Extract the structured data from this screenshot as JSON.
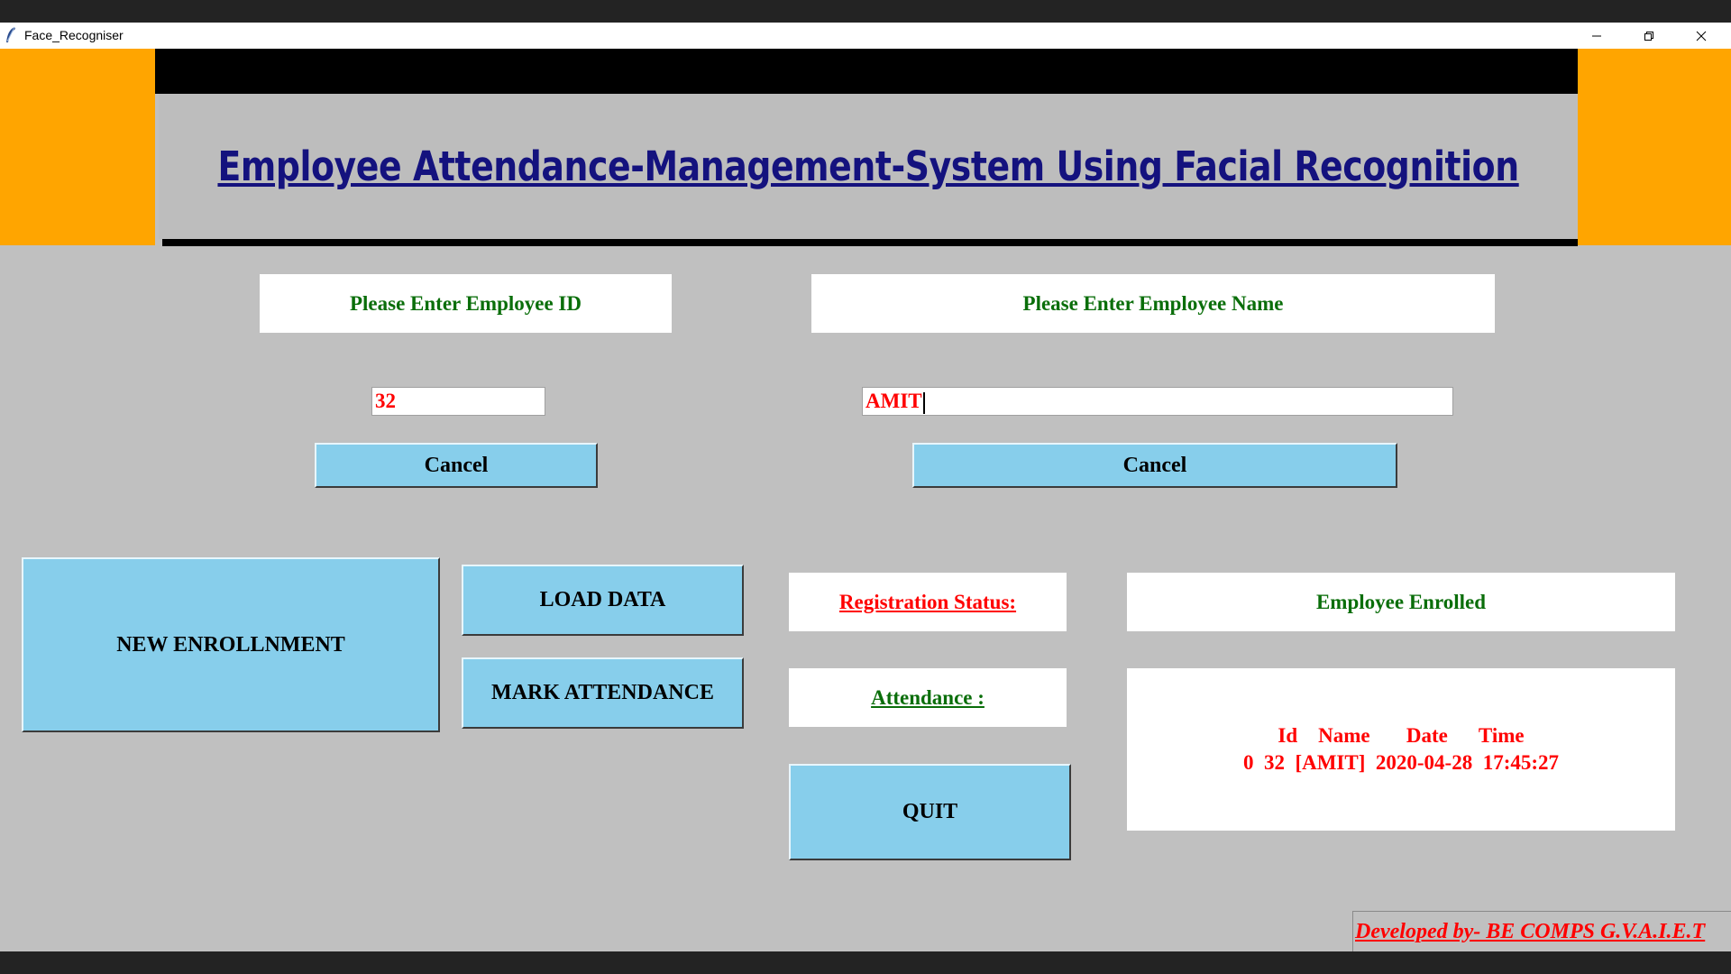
{
  "window": {
    "title": "Face_Recogniser",
    "controls": [
      "minimize-icon",
      "restore-icon",
      "close-icon"
    ]
  },
  "header": {
    "title": "Employee Attendance-Management-System Using Facial Recognition"
  },
  "form": {
    "id_label": "Please Enter Employee ID",
    "name_label": "Please Enter Employee Name",
    "id_value": "32",
    "name_value": "AMIT",
    "cancel_id_label": "Cancel",
    "cancel_name_label": "Cancel"
  },
  "actions": {
    "new_enrollment": "NEW ENROLLNMENT",
    "load_data": "LOAD DATA",
    "mark_attendance": "MARK ATTENDANCE",
    "quit": "QUIT"
  },
  "status": {
    "registration_label": "Registration Status: ",
    "registration_value": "Employee Enrolled",
    "attendance_label": "Attendance : ",
    "attendance_header": "Id    Name       Date      Time",
    "attendance_row": "0  32  [AMIT]  2020-04-28  17:45:27"
  },
  "footer": {
    "credit": "Developed by- BE COMPS G.V.A.I.E.T"
  },
  "colors": {
    "accent_orange": "#ffa500",
    "button_blue": "#87ceeb",
    "title_navy": "#14127e",
    "label_green": "#0a6e0a",
    "value_red": "#ff0000",
    "background_gray": "#c0c0c0"
  }
}
